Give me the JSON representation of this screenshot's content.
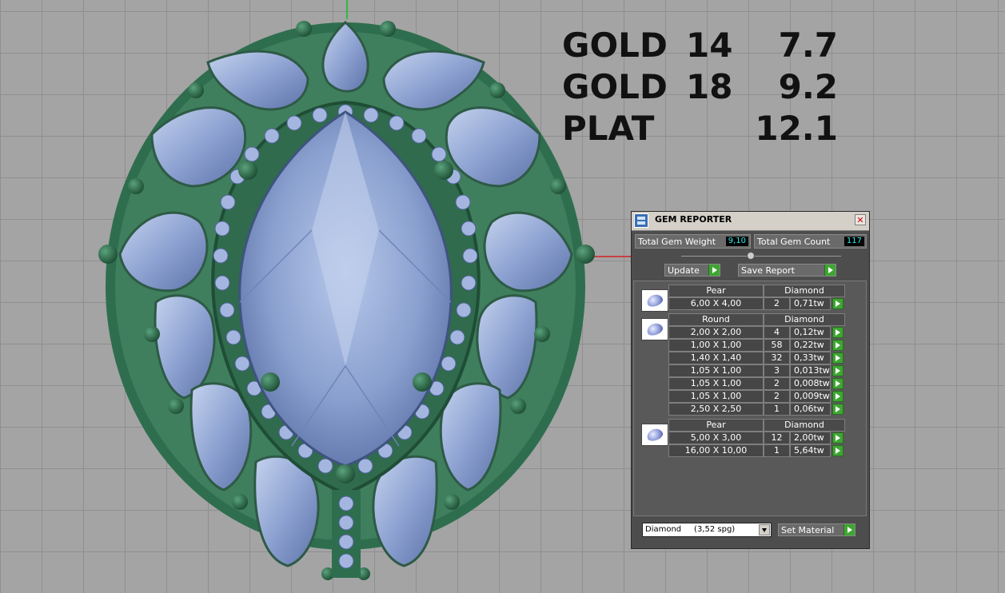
{
  "metal_weights": [
    {
      "metal": "GOLD",
      "karat": "14",
      "weight": "7.7"
    },
    {
      "metal": "GOLD",
      "karat": "18",
      "weight": "9.2"
    },
    {
      "metal": "PLAT",
      "karat": "",
      "weight": "12.1"
    }
  ],
  "panel": {
    "title": "GEM REPORTER",
    "total_weight_label": "Total Gem Weight",
    "total_weight_value": "9,10",
    "total_count_label": "Total Gem Count",
    "total_count_value": "117",
    "update_label": "Update",
    "save_report_label": "Save Report",
    "groups": [
      {
        "shape": "Pear",
        "material": "Diamond",
        "rows": [
          {
            "size": "6,00 X 4,00",
            "count": "2",
            "tw": "0,71tw"
          }
        ]
      },
      {
        "shape": "Round",
        "material": "Diamond",
        "rows": [
          {
            "size": "2,00 X 2,00",
            "count": "4",
            "tw": "0,12tw"
          },
          {
            "size": "1,00 X 1,00",
            "count": "58",
            "tw": "0,22tw"
          },
          {
            "size": "1,40 X 1,40",
            "count": "32",
            "tw": "0,33tw"
          },
          {
            "size": "1,05 X 1,00",
            "count": "3",
            "tw": "0,013tw"
          },
          {
            "size": "1,05 X 1,00",
            "count": "2",
            "tw": "0,008tw"
          },
          {
            "size": "1,05 X 1,00",
            "count": "2",
            "tw": "0,009tw"
          },
          {
            "size": "2,50 X 2,50",
            "count": "1",
            "tw": "0,06tw"
          }
        ]
      },
      {
        "shape": "Pear",
        "material": "Diamond",
        "rows": [
          {
            "size": "5,00 X 3,00",
            "count": "12",
            "tw": "2,00tw"
          },
          {
            "size": "16,00 X 10,00",
            "count": "1",
            "tw": "5,64tw"
          }
        ]
      }
    ],
    "material_select": "Diamond     (3,52 spg)",
    "set_material_label": "Set Material"
  },
  "colors": {
    "gem_blue": "#7f96c9",
    "metal_green": "#2e6e4e",
    "panel_bg": "#4d4d4d",
    "value_cyan": "#2ff0f0",
    "arrow_green": "#3ea632"
  }
}
